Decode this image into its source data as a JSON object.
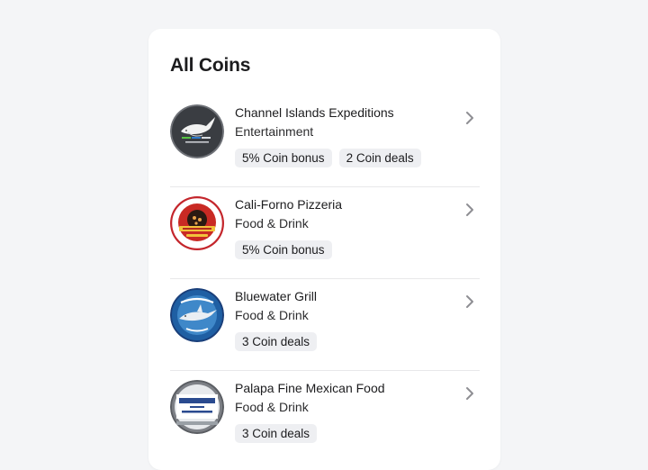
{
  "page": {
    "title": "All Coins"
  },
  "colors": {
    "background": "#f4f5f7",
    "card": "#ffffff",
    "badge": "#eeeff2",
    "chevron": "#8e8e93"
  },
  "merchants": [
    {
      "name": "Channel Islands Expeditions",
      "category": "Entertainment",
      "badges": [
        "5% Coin bonus",
        "2 Coin deals"
      ],
      "logo_icon": "whale-logo-icon"
    },
    {
      "name": "Cali-Forno Pizzeria",
      "category": "Food & Drink",
      "badges": [
        "5% Coin bonus"
      ],
      "logo_icon": "pizza-logo-icon"
    },
    {
      "name": "Bluewater Grill",
      "category": "Food & Drink",
      "badges": [
        "3 Coin deals"
      ],
      "logo_icon": "swordfish-logo-icon"
    },
    {
      "name": "Palapa Fine Mexican Food",
      "category": "Food & Drink",
      "badges": [
        "3 Coin deals"
      ],
      "logo_icon": "palapa-logo-icon"
    }
  ]
}
